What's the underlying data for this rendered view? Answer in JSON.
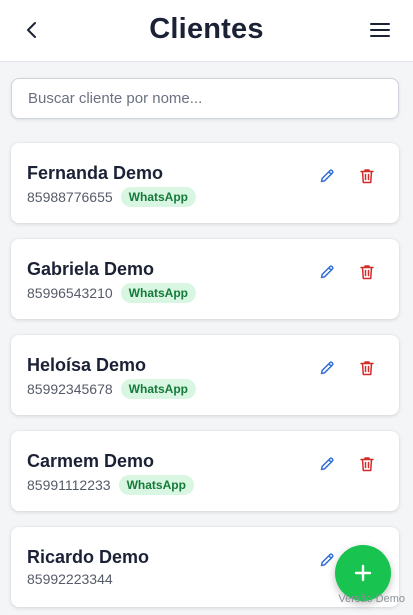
{
  "header": {
    "title": "Clientes",
    "back_icon": "chevron-left-icon",
    "menu_icon": "hamburger-menu-icon"
  },
  "search": {
    "placeholder": "Buscar cliente por nome...",
    "value": ""
  },
  "clients": [
    {
      "name": "Fernanda Demo",
      "phone": "85988776655",
      "badge": "WhatsApp"
    },
    {
      "name": "Gabriela Demo",
      "phone": "85996543210",
      "badge": "WhatsApp"
    },
    {
      "name": "Heloísa Demo",
      "phone": "85992345678",
      "badge": "WhatsApp"
    },
    {
      "name": "Carmem Demo",
      "phone": "85991112233",
      "badge": "WhatsApp"
    },
    {
      "name": "Ricardo Demo",
      "phone": "85992223344",
      "badge": ""
    }
  ],
  "fab": {
    "icon": "plus-icon"
  },
  "footer": {
    "demo_label": "Versão Demo"
  },
  "colors": {
    "accent_green": "#18c34f",
    "edit_blue": "#2f6fd6",
    "delete_red": "#d42a2a",
    "badge_bg": "#d9f6e2",
    "badge_text": "#157a3a"
  }
}
